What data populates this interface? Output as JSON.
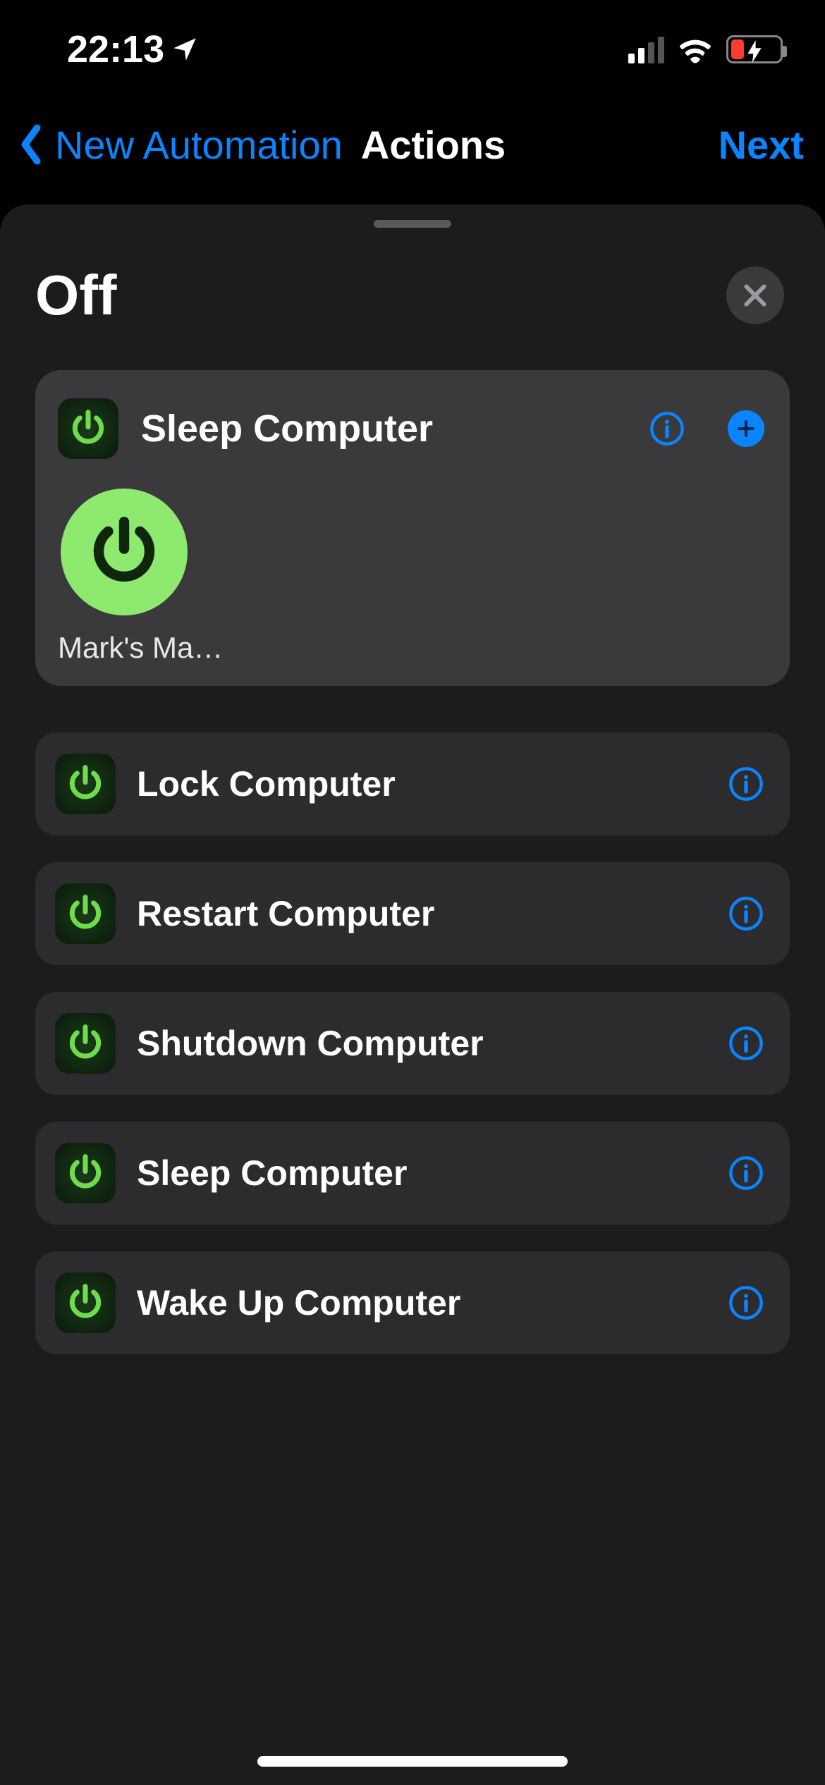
{
  "status": {
    "time": "22:13"
  },
  "nav": {
    "back_label": "New Automation",
    "title": "Actions",
    "next_label": "Next"
  },
  "sheet": {
    "title": "Off",
    "selected_action": {
      "title": "Sleep Computer",
      "device_label": "Mark's Mac..."
    },
    "actions": [
      {
        "label": "Lock Computer"
      },
      {
        "label": "Restart Computer"
      },
      {
        "label": "Shutdown Computer"
      },
      {
        "label": "Sleep Computer"
      },
      {
        "label": "Wake Up Computer"
      }
    ]
  }
}
